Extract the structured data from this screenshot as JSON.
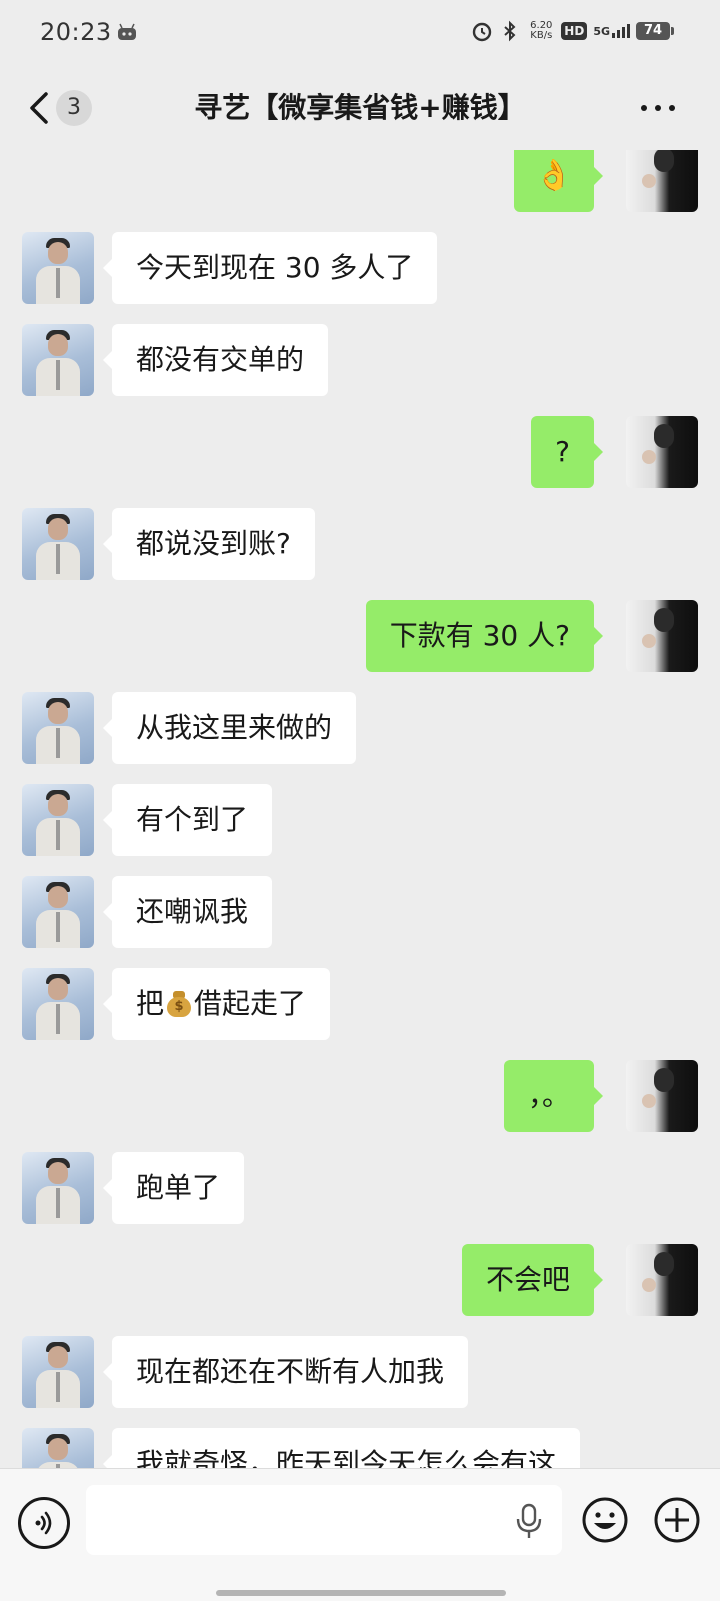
{
  "status_bar": {
    "time": "20:23",
    "net_speed_value": "6.20",
    "net_speed_unit": "KB/s",
    "hd_label": "HD",
    "network_type": "5G",
    "battery": "74"
  },
  "header": {
    "back_icon": "chevron-left-icon",
    "unread_count": "3",
    "title": "寻艺【微享集省钱+赚钱】",
    "more_icon": "more-dots-icon"
  },
  "messages": [
    {
      "side": "right",
      "text": "👌"
    },
    {
      "side": "left",
      "text": "今天到现在 30 多人了"
    },
    {
      "side": "left",
      "text": "都没有交单的"
    },
    {
      "side": "right",
      "text": "?"
    },
    {
      "side": "left",
      "text": "都说没到账?"
    },
    {
      "side": "right",
      "text": "下款有 30 人?"
    },
    {
      "side": "left",
      "text": "从我这里来做的"
    },
    {
      "side": "left",
      "text": "有个到了"
    },
    {
      "side": "left",
      "text": "还嘲讽我"
    },
    {
      "side": "left",
      "text_before": "把",
      "emoji": "money-bag-icon",
      "text_after": "借起走了"
    },
    {
      "side": "right",
      "text": "，。"
    },
    {
      "side": "left",
      "text": "跑单了"
    },
    {
      "side": "right",
      "text": "不会吧"
    },
    {
      "side": "left",
      "text": "现在都还在不断有人加我"
    },
    {
      "side": "left",
      "text": "我就奇怪，昨天到今天怎么会有这"
    }
  ],
  "input_bar": {
    "voice_icon": "voice-icon",
    "placeholder": "",
    "mic_icon": "microphone-icon",
    "emoji_icon": "emoji-icon",
    "plus_icon": "plus-icon"
  },
  "colors": {
    "background": "#ededed",
    "outgoing_bubble": "#95ec69",
    "incoming_bubble": "#ffffff"
  }
}
